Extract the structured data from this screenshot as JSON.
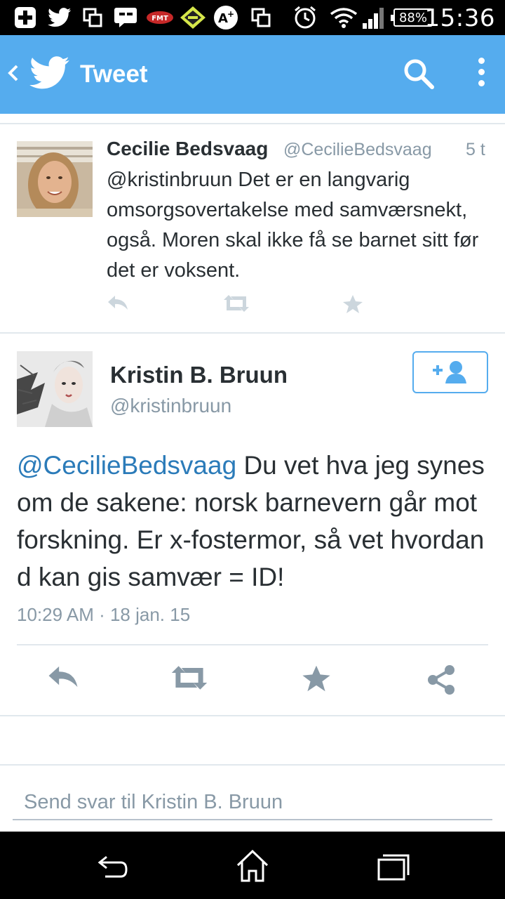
{
  "status_bar": {
    "time": "15:36",
    "battery": "88%",
    "notification_icons": [
      "add-icon",
      "twitter-icon",
      "copy-icon",
      "message-icon",
      "fmt-app-icon",
      "game-icon",
      "plus-app-icon",
      "copy-icon",
      "alarm-icon",
      "wifi-icon",
      "signal-icon"
    ]
  },
  "action_bar": {
    "title": "Tweet",
    "background": "#55acee"
  },
  "conversation_tweet": {
    "name": "Cecilie Bedsvaag",
    "handle": "@CecilieBedsvaag",
    "time": "5 t",
    "text": "@kristinbruun Det er en langvarig omsorgsovertakelse med samværsnekt, også. Moren skal ikke få se barnet sitt før det er voksent."
  },
  "main_tweet": {
    "name": "Kristin B. Bruun",
    "handle": "@kristinbruun",
    "mention": "@CecilieBedsvaag",
    "text": " Du vet hva jeg synes om de sakene: norsk barnevern går mot forskning. Er x-fostermor, så vet hvordan d kan gis samvær = ID!",
    "timestamp": "10:29 AM · 18 jan. 15",
    "mention_color": "#2b7bb9"
  },
  "reply": {
    "placeholder": "Send svar til Kristin B. Bruun"
  }
}
